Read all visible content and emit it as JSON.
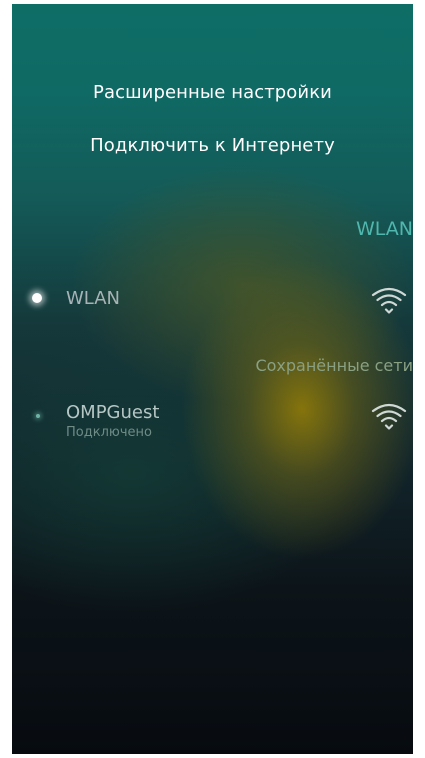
{
  "menu": {
    "advanced_label": "Расширенные настройки",
    "connect_label": "Подключить к Интернету"
  },
  "wlan_section": {
    "header": "WLAN",
    "toggle_label": "WLAN",
    "toggle_on": true,
    "signal_icon": "wifi-signal-icon"
  },
  "saved_section": {
    "header": "Сохранённые сети",
    "networks": [
      {
        "ssid": "OMPGuest",
        "status": "Подключено",
        "signal_icon": "wifi-signal-icon"
      }
    ]
  },
  "colors": {
    "accent": "#4fb7ad",
    "text_primary": "#ffffff",
    "text_secondary": "#a7b3b6"
  }
}
